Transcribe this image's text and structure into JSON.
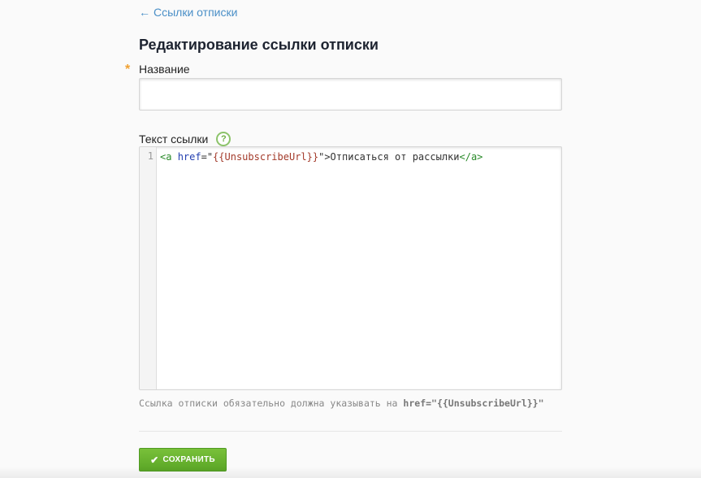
{
  "nav": {
    "back_arrow": "←",
    "back_label": "Ссылки отписки"
  },
  "page": {
    "title": "Редактирование ссылки отписки"
  },
  "form": {
    "name": {
      "required_mark": "*",
      "label": "Название",
      "value": "",
      "placeholder": ""
    },
    "link_text": {
      "label": "Текст ссылки",
      "help_icon": "?",
      "editor": {
        "line_number": "1",
        "tokens": {
          "open_tag": "<a",
          "attr": "href",
          "eq_quote": "=\"",
          "value": "{{UnsubscribeUrl}}",
          "close_quote": "\">",
          "text": "Отписаться от рассылки",
          "close_tag": "</a>"
        }
      }
    },
    "hint": {
      "text": "Ссылка отписки обязательно должна указывать на ",
      "code": "href=\"{{UnsubscribeUrl}}\""
    },
    "save_button": {
      "icon": "✔",
      "label": "СОХРАНИТЬ"
    }
  },
  "colors": {
    "link": "#4a8fc7",
    "required": "#f0a030",
    "accent_green": "#5aa526"
  }
}
